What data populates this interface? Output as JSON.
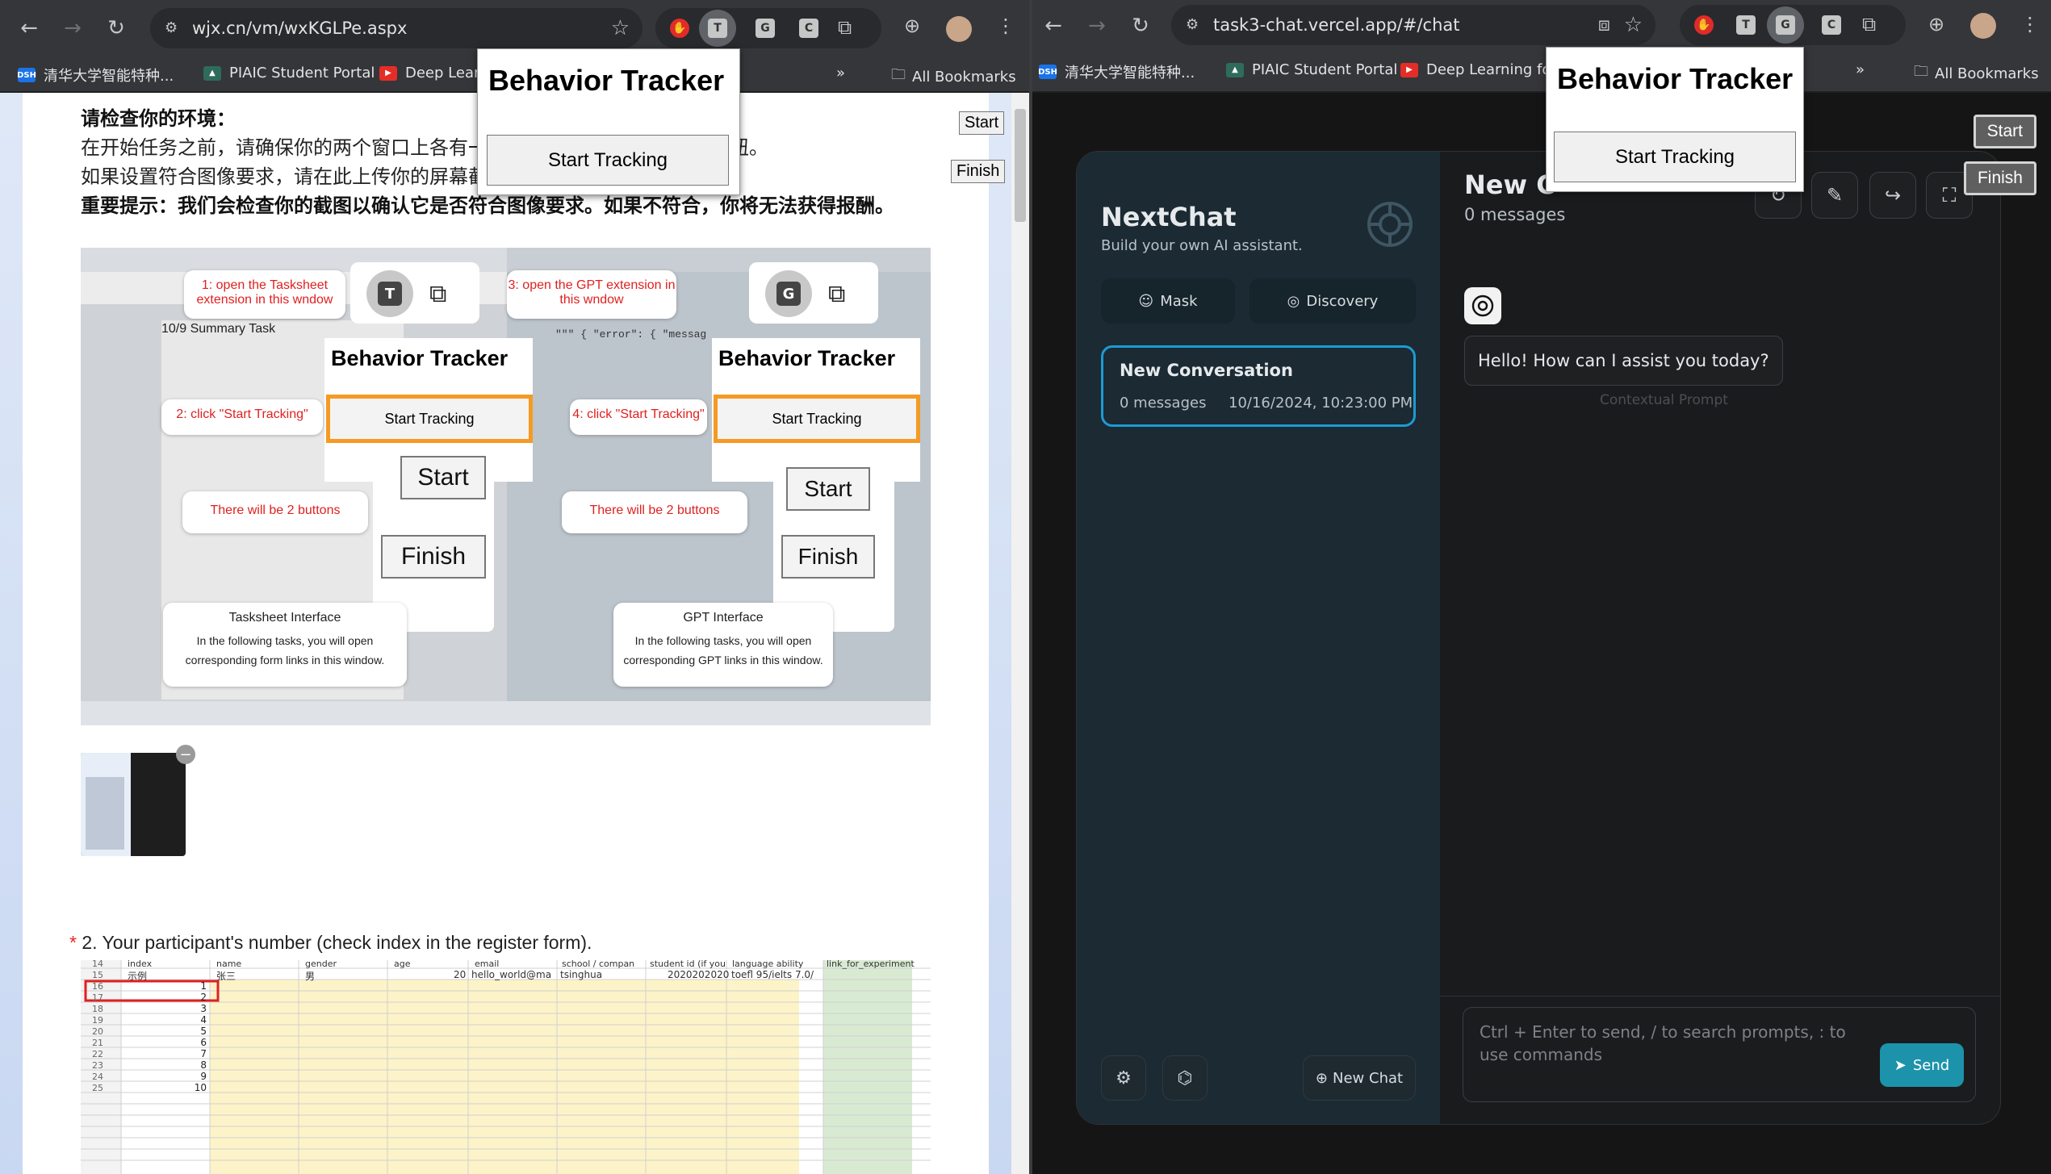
{
  "left": {
    "url": "wjx.cn/vm/wxKGLPe.aspx",
    "ext_labels": [
      "T",
      "G",
      "C"
    ],
    "bookmarks": [
      "清华大学智能特种...",
      "PIAIC Student Portal",
      "Deep Learn"
    ],
    "all_bookmarks": "All Bookmarks",
    "more": "»",
    "popup": {
      "title": "Behavior Tracker",
      "button": "Start Tracking"
    },
    "float_start": "Start",
    "float_finish": "Finish",
    "env_title": "请检查你的环境：",
    "env_line1": "在开始任务之前，请确保你的两个窗口上各有一",
    "env_line1_tail": "扭。",
    "env_line2": "如果设置符合图像要求，请在此上传你的屏幕截",
    "env_line3": "重要提示：我们会检查你的截图以确认它是否符合图像要求。如果不符合，你将无法获得报酬。",
    "guide": {
      "card1": "1: open the Tasksheet extension in this wndow",
      "card2": "2: click \"Start Tracking\"",
      "card3": "3: open the GPT extension in this wndow",
      "card4": "4: click \"Start Tracking\"",
      "two_buttons_left": "There will be 2 buttons",
      "two_buttons_right": "There will be 2 buttons",
      "bt_title": "Behavior Tracker",
      "bt_button": "Start Tracking",
      "start": "Start",
      "finish": "Finish",
      "t_icon": "T",
      "g_icon": "G",
      "summary_title": "10/9 Summary Task",
      "error_snippet": "\"\"\" { \"error\": { \"messag",
      "tasksheet_title": "Tasksheet Interface",
      "tasksheet_desc": "In the following tasks, you will open corresponding form links in this window.",
      "gpt_title": "GPT Interface",
      "gpt_desc": "In the following tasks, you will open corresponding GPT links in this window."
    },
    "q2_star": "*",
    "q2_text": "2. Your participant's number (check index in the register form).",
    "sheet": {
      "headers": [
        "index",
        "name",
        "gender",
        "age",
        "email",
        "school / compan",
        "student id (if you",
        "language ability",
        "link_for_experiment"
      ],
      "example_row": [
        "示例",
        "张三",
        "男",
        "20",
        "hello_world@ma",
        "tsinghua",
        "2020202020",
        "toefl 95/ielts 7.0/",
        ""
      ],
      "row_numbers": [
        "14",
        "15",
        "16",
        "17",
        "18",
        "19",
        "20",
        "21",
        "22",
        "23",
        "24",
        "25"
      ],
      "index_values": [
        "1",
        "2",
        "3",
        "4",
        "5",
        "6",
        "7",
        "8",
        "9",
        "10"
      ]
    }
  },
  "right": {
    "url": "task3-chat.vercel.app/#/chat",
    "ext_labels": [
      "T",
      "G",
      "C"
    ],
    "bookmarks": [
      "清华大学智能特种...",
      "PIAIC Student Portal",
      "Deep Learning for"
    ],
    "all_bookmarks": "All Bookmarks",
    "more": "»",
    "popup": {
      "title": "Behavior Tracker",
      "button": "Start Tracking"
    },
    "float_start": "Start",
    "float_finish": "Finish",
    "app_name": "NextChat",
    "app_tagline": "Build your own AI assistant.",
    "mask": "Mask",
    "discovery": "Discovery",
    "conversation": {
      "title": "New Conversation",
      "count": "0 messages",
      "date": "10/16/2024, 10:23:00 PM"
    },
    "new_chat": "New Chat",
    "chat_title": "New C",
    "chat_subtitle": "0 messages",
    "greeting": "Hello! How can I assist you today?",
    "contextual_prompt": "Contextual Prompt",
    "input_placeholder": "Ctrl + Enter to send, / to search prompts, : to use commands",
    "send": "Send"
  },
  "colors": {
    "accent": "#1d93ab",
    "conv_border": "#1e9ad3",
    "tracker_orange": "#f59a23"
  }
}
